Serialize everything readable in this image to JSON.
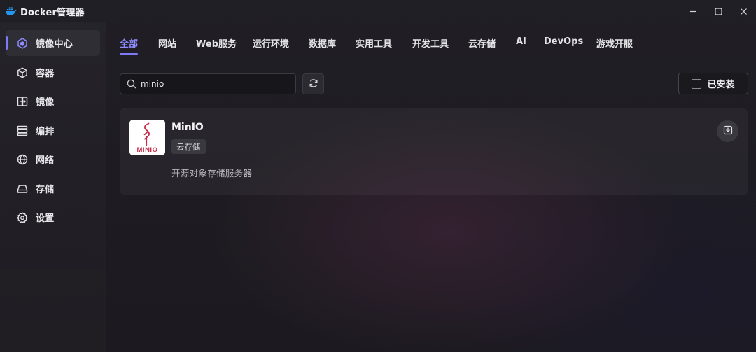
{
  "window": {
    "title": "Docker管理器",
    "logo_icon": "docker-whale-icon",
    "controls": [
      "minimize-icon",
      "maximize-icon",
      "close-icon"
    ]
  },
  "sidebar": {
    "items": [
      {
        "label": "镜像中心",
        "icon": "cube-hex-icon",
        "active": true
      },
      {
        "label": "容器",
        "icon": "box-icon",
        "active": false
      },
      {
        "label": "镜像",
        "icon": "image-copy-icon",
        "active": false
      },
      {
        "label": "编排",
        "icon": "layers-icon",
        "active": false
      },
      {
        "label": "网络",
        "icon": "globe-icon",
        "active": false
      },
      {
        "label": "存储",
        "icon": "drive-icon",
        "active": false
      },
      {
        "label": "设置",
        "icon": "gear-icon",
        "active": false
      }
    ]
  },
  "tabs": [
    {
      "label": "全部",
      "active": true
    },
    {
      "label": "网站",
      "active": false
    },
    {
      "label": "Web服务",
      "active": false
    },
    {
      "label": "运行环境",
      "active": false
    },
    {
      "label": "数据库",
      "active": false
    },
    {
      "label": "实用工具",
      "active": false
    },
    {
      "label": "开发工具",
      "active": false
    },
    {
      "label": "云存储",
      "active": false
    },
    {
      "label": "AI",
      "active": false
    },
    {
      "label": "DevOps",
      "active": false
    },
    {
      "label": "游戏开服",
      "active": false
    }
  ],
  "search": {
    "value": "minio",
    "placeholder": ""
  },
  "filters": {
    "installed_label": "已安装",
    "installed_checked": false
  },
  "apps": [
    {
      "name": "MinIO",
      "tag": "云存储",
      "description": "开源对象存储服务器",
      "logo_text": "MINIO",
      "logo_color": "#c72c48",
      "action_icon": "download-install-icon"
    }
  ],
  "colors": {
    "accent": "#7c7af5",
    "accent_text": "#8f8cff",
    "docker_blue": "#2496ed"
  }
}
